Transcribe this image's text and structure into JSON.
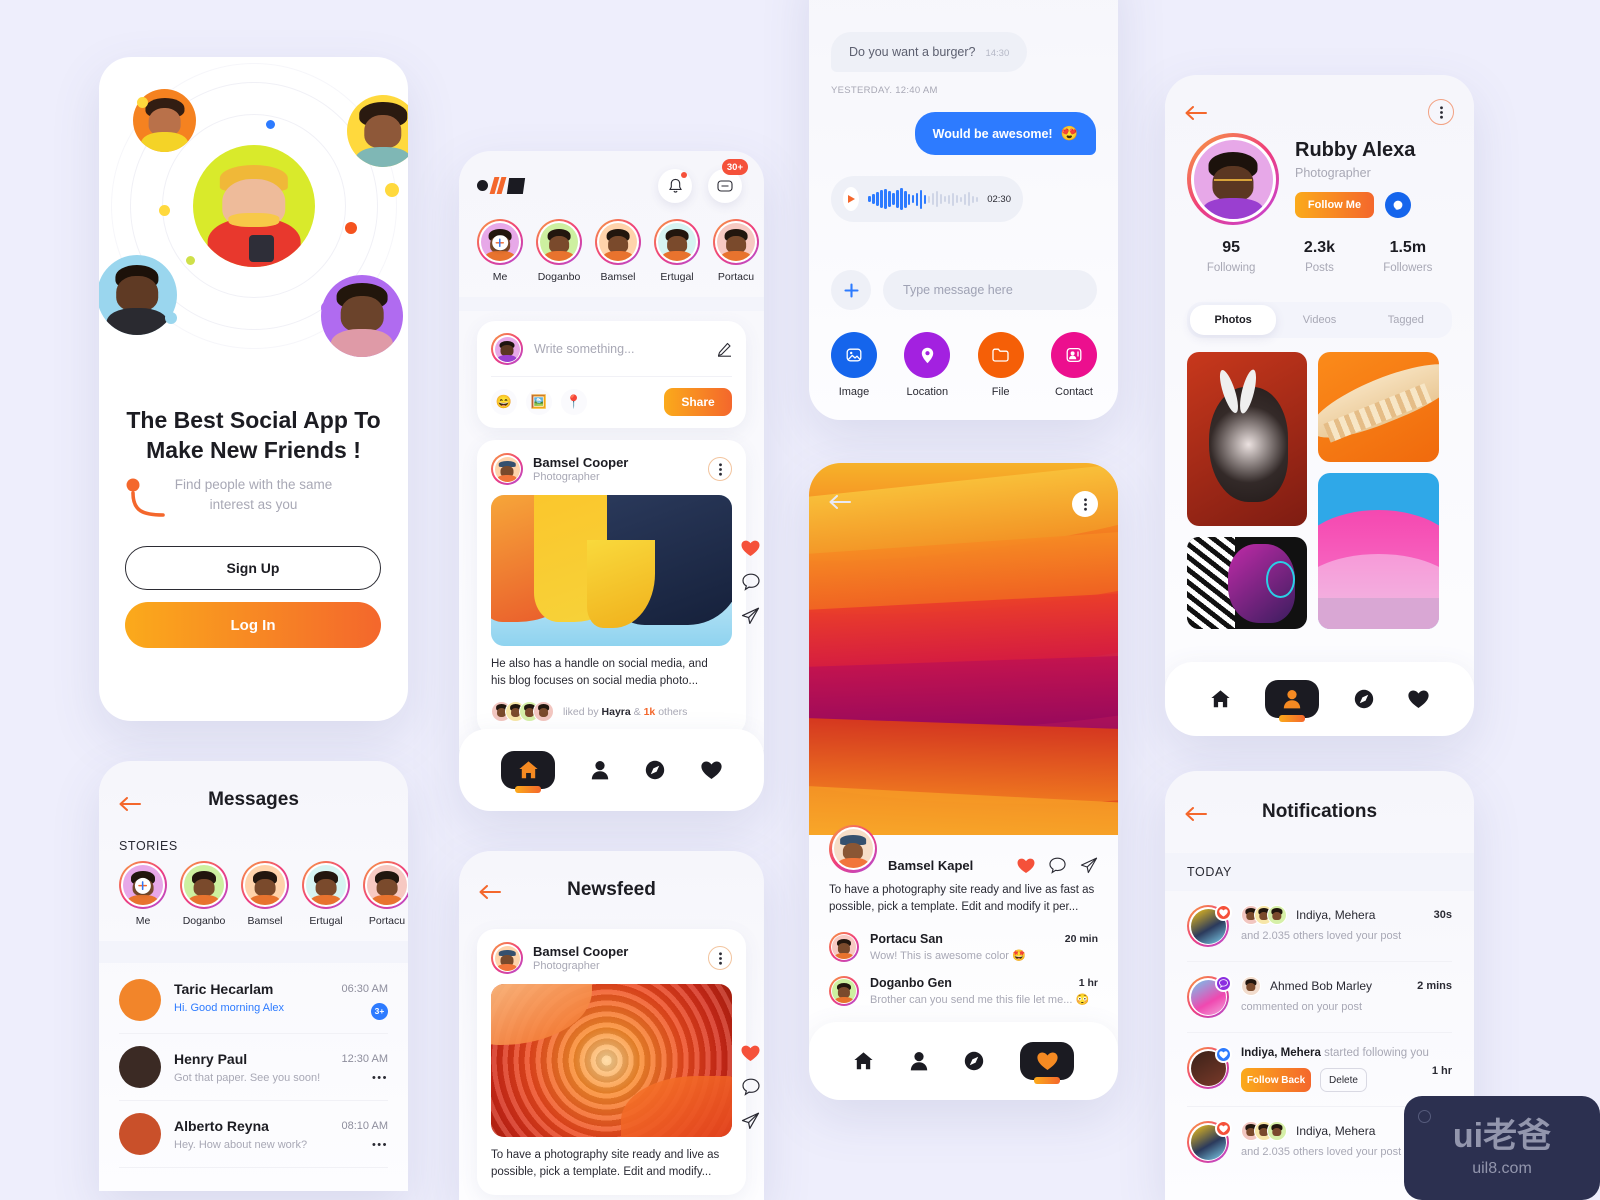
{
  "meta": {
    "background": "#eeeefc",
    "accent_start": "#fbaa1b",
    "accent_end": "#f4672c"
  },
  "watermark": {
    "logo": "ui老爸",
    "url": "uil8.com"
  },
  "onboarding": {
    "headline_line1": "The Best Social App To",
    "headline_line2": "Make New Friends !",
    "subline1": "Find people with the same",
    "subline2": "interest as you",
    "signup_label": "Sign Up",
    "login_label": "Log In",
    "orbit_colors": [
      "#f58220",
      "#ffd93d",
      "#9ad6ee",
      "#b06bf0",
      "#d9ea2b"
    ]
  },
  "messages": {
    "back_icon": "arrow-left-icon",
    "title": "Messages",
    "stories_label": "STORIES",
    "stories": [
      {
        "name": "Me",
        "bg": "#e7a8e8",
        "add": true
      },
      {
        "name": "Doganbo",
        "bg": "#cdf0a0",
        "add": false
      },
      {
        "name": "Bamsel",
        "bg": "#ffd3ab",
        "add": false
      },
      {
        "name": "Ertugal",
        "bg": "#d6f4f2",
        "add": false
      },
      {
        "name": "Portacu",
        "bg": "#f7c9c2",
        "add": false
      }
    ],
    "threads": [
      {
        "name": "Taric Hecarlam",
        "preview": "Hi. Good morning Alex",
        "time": "06:30 AM",
        "badge": "3+",
        "unread": true,
        "thumb": "#f2852a"
      },
      {
        "name": "Henry Paul",
        "preview": "Got that paper. See you soon!",
        "time": "12:30 AM",
        "badge": "",
        "unread": false,
        "thumb": "#3b2a24"
      },
      {
        "name": "Alberto Reyna",
        "preview": "Hey. How about new work?",
        "time": "08:10 AM",
        "badge": "",
        "unread": false,
        "thumb": "#c9502a"
      }
    ]
  },
  "feed": {
    "logo_name": "app-logo",
    "bell_icon": "bell-icon",
    "message_icon": "message-icon",
    "message_badge": "30+",
    "stories": [
      {
        "name": "Me",
        "bg": "#e7a8e8",
        "add": true
      },
      {
        "name": "Doganbo",
        "bg": "#cdf0a0",
        "add": false
      },
      {
        "name": "Bamsel",
        "bg": "#ffd3ab",
        "add": false
      },
      {
        "name": "Ertugal",
        "bg": "#d6f4f2",
        "add": false
      },
      {
        "name": "Portacu",
        "bg": "#f7c9c2",
        "add": false
      }
    ],
    "composer": {
      "placeholder": "Write something...",
      "edit_icon": "pencil-icon",
      "chips": [
        "emoji-icon",
        "photo-icon",
        "location-icon"
      ],
      "share_label": "Share"
    },
    "post": {
      "author": "Bamsel Cooper",
      "role": "Photographer",
      "more_icon": "more-vertical-icon",
      "caption_line1": "He also has a handle on social media, and",
      "caption_line2": "his blog focuses on social media  photo...",
      "liked_prefix": "liked by",
      "liked_name": "Hayra",
      "liked_amp": "&",
      "liked_count": "1k",
      "liked_suffix": "others",
      "like_icon": "heart-icon",
      "comment_icon": "comment-icon",
      "share_icon": "send-icon"
    },
    "nav": [
      {
        "icon": "home-icon",
        "active": true
      },
      {
        "icon": "person-icon",
        "active": false
      },
      {
        "icon": "compass-icon",
        "active": false
      },
      {
        "icon": "heart-icon",
        "active": false
      }
    ]
  },
  "newsfeed": {
    "back_icon": "arrow-left-icon",
    "title": "Newsfeed",
    "post": {
      "author": "Bamsel Cooper",
      "role": "Photographer",
      "more_icon": "more-vertical-icon",
      "caption_line1": "To have a photography site ready and live as",
      "caption_line2": "possible, pick a template. Edit and modify...",
      "like_icon": "heart-icon",
      "comment_icon": "comment-icon",
      "share_icon": "send-icon"
    }
  },
  "chat": {
    "messages": [
      {
        "side": "out",
        "text": "",
        "time": "",
        "partial": true
      },
      {
        "side": "in",
        "text": "Do you want a burger?",
        "time": "14:30",
        "partial": false
      }
    ],
    "day_divider": "YESTERDAY. 12:40 AM",
    "reply": {
      "text": "Would be awesome!",
      "emoji": "😍"
    },
    "voice": {
      "play_icon": "play-icon",
      "duration": "02:30"
    },
    "input": {
      "add_icon": "plus-icon",
      "placeholder": "Type message here"
    },
    "attachments": [
      {
        "label": "Image",
        "icon": "image-icon",
        "color": "#1565ec"
      },
      {
        "label": "Location",
        "icon": "pin-icon",
        "color": "#a321e0"
      },
      {
        "label": "File",
        "icon": "folder-icon",
        "color": "#f55f07"
      },
      {
        "label": "Contact",
        "icon": "contact-icon",
        "color": "#ec0f8e"
      }
    ]
  },
  "photo": {
    "back_icon": "arrow-left-icon",
    "more_icon": "more-vertical-icon",
    "author": "Bamsel Kapel",
    "like_icon": "heart-icon",
    "comment_icon": "comment-icon",
    "share_icon": "send-icon",
    "caption_line1": "To have a photography site ready and live as fast as",
    "caption_line2": "possible, pick a template. Edit and modify it per...",
    "comments": [
      {
        "name": "Portacu San",
        "text": "Wow! This is awesome color",
        "emoji": "🤩",
        "time": "20 min",
        "bg": "#f7c9c2"
      },
      {
        "name": "Doganbo Gen",
        "text": "Brother can you send me this file let me...",
        "emoji": "😳",
        "time": "1 hr",
        "bg": "#cdf0a0"
      }
    ],
    "nav": [
      {
        "icon": "home-icon",
        "active": false
      },
      {
        "icon": "person-icon",
        "active": false
      },
      {
        "icon": "compass-icon",
        "active": false
      },
      {
        "icon": "heart-icon",
        "active": true
      }
    ]
  },
  "profile": {
    "back_icon": "arrow-left-icon",
    "more_icon": "more-vertical-icon",
    "name": "Rubby Alexa",
    "role": "Photographer",
    "follow_label": "Follow Me",
    "message_icon": "chat-bubble-icon",
    "stats": [
      {
        "value": "95",
        "label": "Following"
      },
      {
        "value": "2.3k",
        "label": "Posts"
      },
      {
        "value": "1.5m",
        "label": "Followers"
      }
    ],
    "tabs": [
      {
        "label": "Photos",
        "active": true
      },
      {
        "label": "Videos",
        "active": false
      },
      {
        "label": "Tagged",
        "active": false
      }
    ],
    "nav": [
      {
        "icon": "home-icon",
        "active": false
      },
      {
        "icon": "person-icon",
        "active": true
      },
      {
        "icon": "compass-icon",
        "active": false
      },
      {
        "icon": "heart-icon",
        "active": false
      }
    ]
  },
  "notifications": {
    "back_icon": "arrow-left-icon",
    "title": "Notifications",
    "section_label": "TODAY",
    "items": [
      {
        "names": "Indiya, Mehera",
        "detail": "and 2.035 others loved your post",
        "time": "30s",
        "badge": "heart-icon",
        "badge_color": "#f5513a",
        "stack": true,
        "single_avatar": false,
        "actions": false
      },
      {
        "names": "Ahmed Bob Marley",
        "detail": "commented on your post",
        "time": "2 mins",
        "badge": "comment-icon",
        "badge_color": "#8b2fe0",
        "stack": false,
        "single_avatar": true,
        "actions": false
      },
      {
        "names": "Indiya, Mehera",
        "detail": "started following you",
        "time": "1 hr",
        "badge": "heart-icon",
        "badge_color": "#2d7bff",
        "stack": false,
        "single_avatar": false,
        "actions": true,
        "follow_label": "Follow Back",
        "delete_label": "Delete"
      },
      {
        "names": "Indiya, Mehera",
        "detail": "and 2.035 others loved your post",
        "time": "",
        "badge": "heart-icon",
        "badge_color": "#f5513a",
        "stack": true,
        "single_avatar": false,
        "actions": false
      }
    ]
  }
}
